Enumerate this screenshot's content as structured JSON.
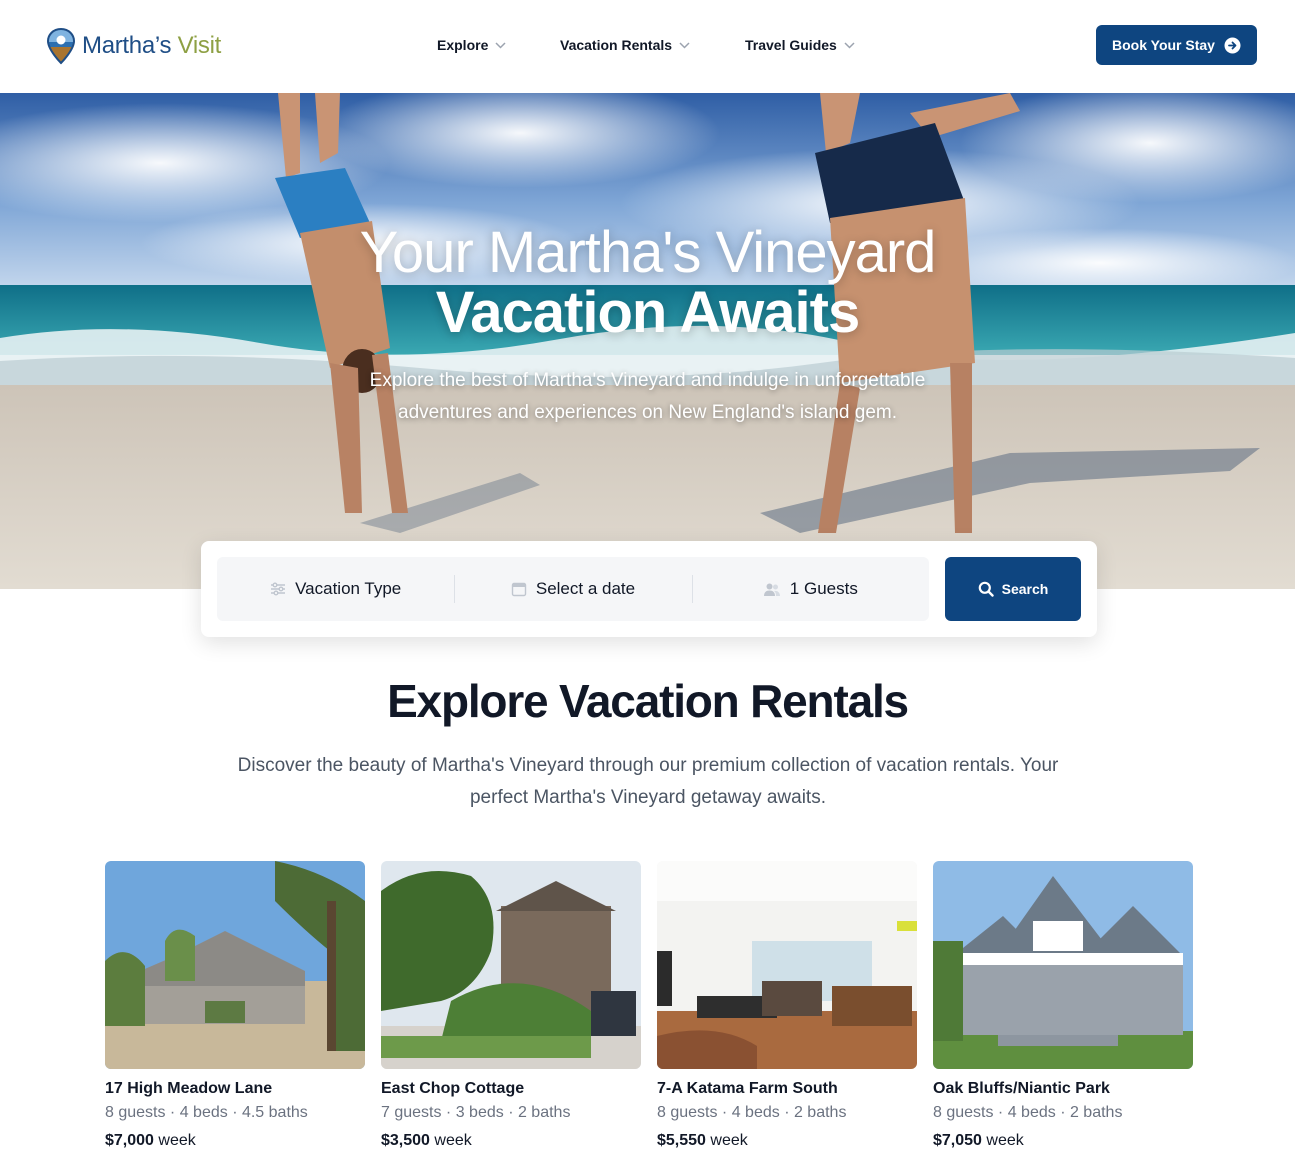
{
  "header": {
    "logo": {
      "part1": "Martha’s",
      "part2": "Visit"
    },
    "nav": [
      {
        "label": "Explore"
      },
      {
        "label": "Vacation Rentals"
      },
      {
        "label": "Travel Guides"
      }
    ],
    "cta_label": "Book Your Stay"
  },
  "hero": {
    "title_line1": "Your Martha's Vineyard",
    "title_line2": "Vacation Awaits",
    "subtitle": "Explore the best of Martha's Vineyard and indulge in unforgettable adventures and experiences on New England's island gem."
  },
  "search": {
    "vacation_type": "Vacation Type",
    "date": "Select a date",
    "guests": "1 Guests",
    "button_label": "Search"
  },
  "rentals_section": {
    "title": "Explore Vacation Rentals",
    "description": "Discover the beauty of Martha's Vineyard through our premium collection of vacation rentals. Your perfect Martha's Vineyard getaway awaits."
  },
  "rentals": [
    {
      "name": "17 High Meadow Lane",
      "details": "8 guests · 4 beds · 4.5 baths",
      "price": "$7,000",
      "unit": "week"
    },
    {
      "name": "East Chop Cottage",
      "details": "7 guests · 3 beds · 2 baths",
      "price": "$3,500",
      "unit": "week"
    },
    {
      "name": "7-A Katama Farm South",
      "details": "8 guests · 4 beds · 2 baths",
      "price": "$5,550",
      "unit": "week"
    },
    {
      "name": "Oak Bluffs/Niantic Park",
      "details": "8 guests · 4 beds · 2 baths",
      "price": "$7,050",
      "unit": "week"
    }
  ],
  "colors": {
    "brand_blue": "#0e4580",
    "logo_blue": "#1f4e86",
    "logo_green": "#8ea044"
  }
}
